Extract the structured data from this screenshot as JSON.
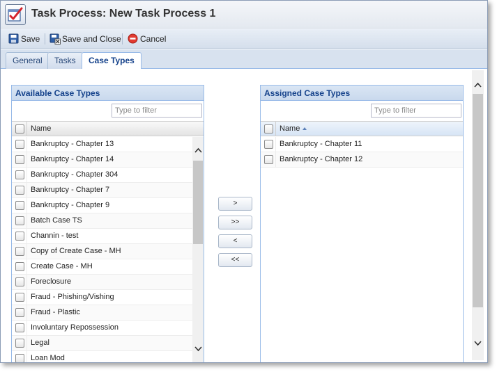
{
  "window": {
    "title": "Task Process: New Task Process 1"
  },
  "toolbar": {
    "save_label": "Save",
    "save_close_label": "Save and Close",
    "cancel_label": "Cancel"
  },
  "tabs": [
    {
      "label": "General",
      "active": false
    },
    {
      "label": "Tasks",
      "active": false
    },
    {
      "label": "Case Types",
      "active": true
    }
  ],
  "available": {
    "title": "Available Case Types",
    "filter_placeholder": "Type to filter",
    "column": "Name",
    "items": [
      "Bankruptcy - Chapter 13",
      "Bankruptcy - Chapter 14",
      "Bankruptcy - Chapter 304",
      "Bankruptcy - Chapter 7",
      "Bankruptcy - Chapter 9",
      "Batch Case TS",
      "Channin - test",
      "Copy of Create Case - MH",
      "Create Case - MH",
      "Foreclosure",
      "Fraud - Phishing/Vishing",
      "Fraud - Plastic",
      "Involuntary Repossession",
      "Legal",
      "Loan Mod"
    ]
  },
  "assigned": {
    "title": "Assigned Case Types",
    "filter_placeholder": "Type to filter",
    "column": "Name",
    "items": [
      "Bankruptcy - Chapter 11",
      "Bankruptcy - Chapter 12"
    ]
  },
  "move_buttons": {
    "add": ">",
    "add_all": ">>",
    "remove": "<",
    "remove_all": "<<"
  },
  "colors": {
    "accent": "#15428b",
    "panel_border": "#99bbe8",
    "header_bg": "#c9d9ed"
  }
}
